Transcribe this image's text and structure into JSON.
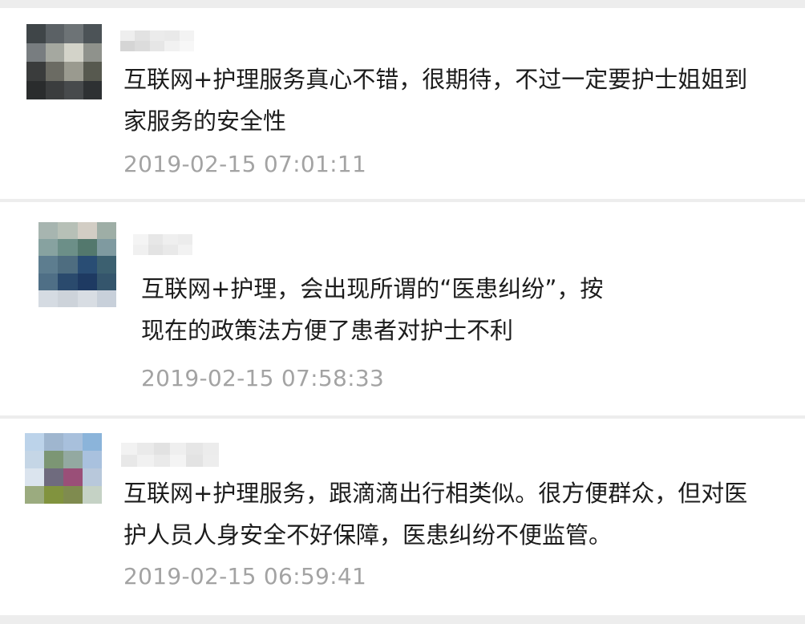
{
  "comments": [
    {
      "lines": [
        "互联网+护理服务真心不错，很期待，不过一定要护士姐姐到",
        "家服务的安全性"
      ],
      "time": "2019-02-15 07:01:11"
    },
    {
      "lines": [
        "互联网+护理，会出现所谓的“医患纠纷”，按",
        "现在的政策法方便了患者对护士不利"
      ],
      "time": "2019-02-15 07:58:33"
    },
    {
      "lines": [
        "互联网+护理服务，跟滴滴出行相类似。很方便群众，但对医",
        "护人员人身安全不好保障，医患纠纷不便监管。"
      ],
      "time": "2019-02-15 06:59:41"
    }
  ],
  "colors": {
    "background": "#ededed",
    "card": "#ffffff",
    "text": "#1c1c1c",
    "timestamp": "#a3a3a3"
  },
  "avatars": [
    {
      "icon": "pixelated-avatar-icon",
      "palette": [
        "#3f4548",
        "#5b6165",
        "#6d7376",
        "#4c5357",
        "#787d80",
        "#a5a8a0",
        "#d3d3c9",
        "#8f928c",
        "#3a3c3c",
        "#6b6b63",
        "#9a9a8f",
        "#57594f",
        "#2a2c2d",
        "#3b3d3e",
        "#474a4c",
        "#2e3133"
      ]
    },
    {
      "icon": "pixelated-avatar-icon",
      "palette": [
        "#a7b5b0",
        "#b7c0b7",
        "#d2cdc4",
        "#9eaea6",
        "#87a2a0",
        "#6c8f88",
        "#53786d",
        "#7f9aa0",
        "#5d7d8f",
        "#4e6d80",
        "#294d74",
        "#3c6070",
        "#4f6f86",
        "#2a4a6d",
        "#1e3a62",
        "#34556c",
        "#d5dbe2",
        "#cdd3da",
        "#d8dde3",
        "#c8d0da"
      ]
    },
    {
      "icon": "pixelated-avatar-icon",
      "palette": [
        "#bcd3ea",
        "#9fb6cf",
        "#a8c0dc",
        "#8bb4da",
        "#c5d6e6",
        "#7c9674",
        "#93a9a1",
        "#a9c1de",
        "#dbe4ee",
        "#6f6b7e",
        "#9a4f78",
        "#b8c8db",
        "#9bab7f",
        "#81933e",
        "#7f8b4f",
        "#c5d2c5"
      ]
    }
  ],
  "name_blurs": [
    [
      "#eeeeee",
      "#e2e2e2",
      "#ebebeb",
      "#e9e9e9",
      "#f3f3f3",
      "#d5d5d5",
      "#dcdcdc",
      "#e6e6e6",
      "#f1f1f1",
      "#f7f7f7"
    ],
    [
      "#f4f4f4",
      "#e7e7e7",
      "#efefef",
      "#ececec",
      "#f0f0f0",
      "#e3e3e3",
      "#e9e9e9",
      "#f2f2f2"
    ],
    [
      "#f2f2f2",
      "#eaeaea",
      "#e2e2e2",
      "#efefef",
      "#e6e6e6",
      "#ececec",
      "#e8e8e8",
      "#f1f1f1",
      "#eaeaea",
      "#f4f4f4",
      "#e3e3e3",
      "#ededed"
    ]
  ]
}
